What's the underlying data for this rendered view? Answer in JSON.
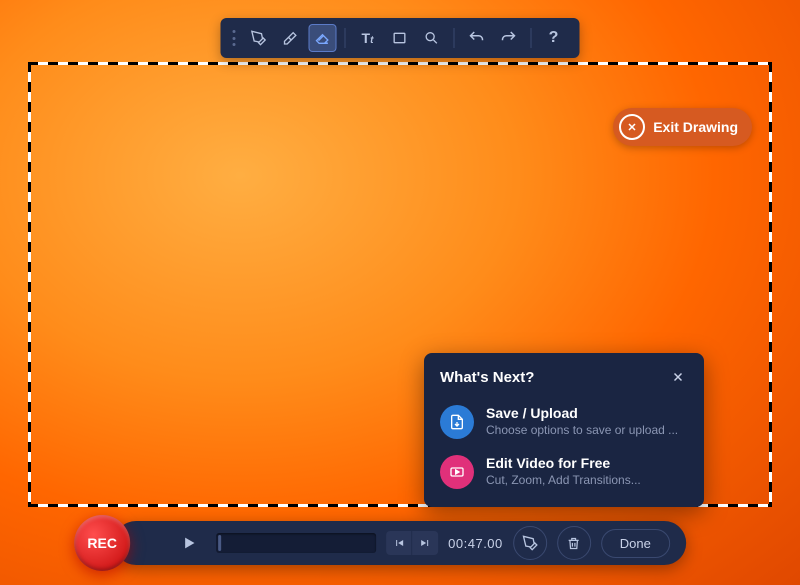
{
  "toolbar": {
    "tools": [
      {
        "name": "pencil"
      },
      {
        "name": "highlighter"
      },
      {
        "name": "eraser",
        "active": true
      },
      {
        "name": "text"
      },
      {
        "name": "rectangle"
      },
      {
        "name": "magnifier"
      }
    ],
    "undo": "undo",
    "redo": "redo",
    "help": "?"
  },
  "exit_button": {
    "label": "Exit Drawing"
  },
  "whats_next": {
    "title": "What's Next?",
    "items": [
      {
        "title": "Save / Upload",
        "subtitle": "Choose options to save or upload ..."
      },
      {
        "title": "Edit Video for Free",
        "subtitle": "Cut, Zoom, Add Transitions..."
      }
    ]
  },
  "bottom": {
    "rec_label": "REC",
    "time": "00:47.00",
    "done_label": "Done"
  }
}
